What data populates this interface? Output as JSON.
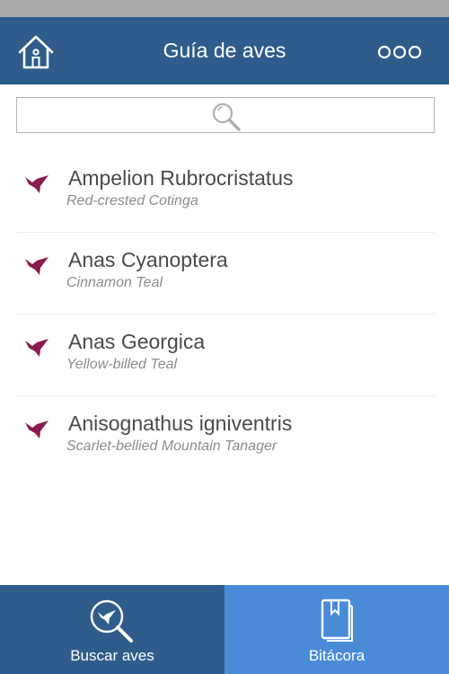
{
  "header": {
    "title": "Guía de aves",
    "home_icon": "home-icon",
    "more_icon": "more-options-icon"
  },
  "search": {
    "icon": "search-icon",
    "value": ""
  },
  "birds": [
    {
      "scientific": "Ampelion Rubrocristatus",
      "common": "Red-crested Cotinga",
      "icon": "bird-icon"
    },
    {
      "scientific": "Anas Cyanoptera",
      "common": "Cinnamon Teal",
      "icon": "bird-icon"
    },
    {
      "scientific": "Anas Georgica",
      "common": "Yellow-billed Teal",
      "icon": "bird-icon"
    },
    {
      "scientific": "Anisognathus igniventris",
      "common": "Scarlet-bellied Mountain Tanager",
      "icon": "bird-icon"
    }
  ],
  "tabs": {
    "search": {
      "label": "Buscar aves",
      "icon": "bird-search-icon"
    },
    "log": {
      "label": "Bitácora",
      "icon": "book-icon"
    }
  },
  "colors": {
    "header": "#2f5c8a",
    "tab_active_alt": "#4a8bd8",
    "bird_icon": "#8b1a4e",
    "status_bar": "#a9a9a9"
  }
}
